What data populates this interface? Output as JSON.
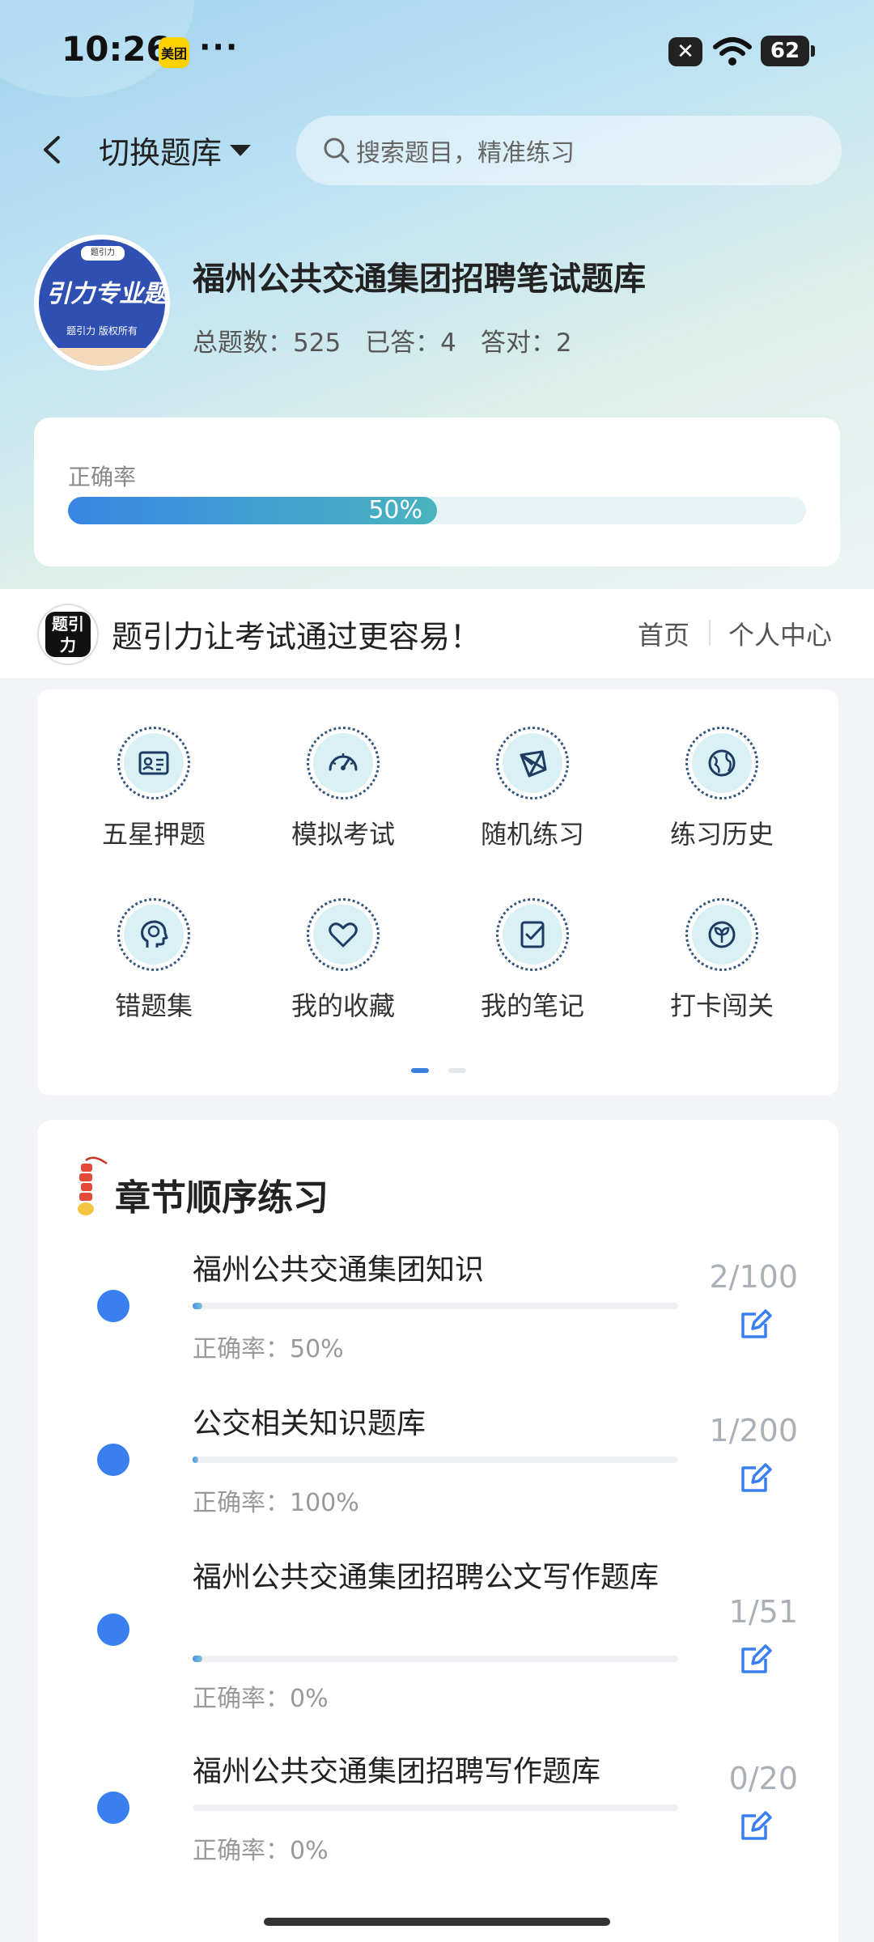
{
  "status_bar": {
    "time": "10:26",
    "meituan_badge": "美团",
    "more": "···",
    "battery": "62"
  },
  "header": {
    "switch_label": "切换题库",
    "search_placeholder": "搜索题目，精准练习"
  },
  "bank": {
    "logo_tab": "题引力",
    "logo_main": "引力专业题",
    "logo_sub": "题引力 版权所有",
    "title": "福州公共交通集团招聘笔试题库",
    "stats": {
      "total": "总题数：525",
      "answered": "已答：4",
      "correct": "答对：2"
    }
  },
  "accuracy": {
    "label": "正确率",
    "value_text": "50%",
    "fraction": 0.5
  },
  "brand_bar": {
    "logo_text": "题引力",
    "slogan": "题引力让考试通过更容易！",
    "home": "首页",
    "profile": "个人中心"
  },
  "features": [
    {
      "label": "五星押题",
      "icon": "id-card-icon"
    },
    {
      "label": "模拟考试",
      "icon": "speedometer-icon"
    },
    {
      "label": "随机练习",
      "icon": "network-icon"
    },
    {
      "label": "练习历史",
      "icon": "globe-icon"
    },
    {
      "label": "错题集",
      "icon": "brain-head-icon"
    },
    {
      "label": "我的收藏",
      "icon": "heart-icon"
    },
    {
      "label": "我的笔记",
      "icon": "note-check-icon"
    },
    {
      "label": "打卡闯关",
      "icon": "leaf-icon"
    }
  ],
  "chapters": {
    "title": "章节顺序练习",
    "items": [
      {
        "name": "福州公共交通集团知识",
        "accuracy": "正确率：50%",
        "count": "2/100",
        "progress": 0.02
      },
      {
        "name": "公交相关知识题库",
        "accuracy": "正确率：100%",
        "count": "1/200",
        "progress": 0.005
      },
      {
        "name": "福州公共交通集团招聘公文写作题库",
        "accuracy": "正确率：0%",
        "count": "1/51",
        "progress": 0.02
      },
      {
        "name": "福州公共交通集团招聘写作题库",
        "accuracy": "正确率：0%",
        "count": "0/20",
        "progress": 0
      }
    ]
  },
  "colors": {
    "accent": "#3a7ff0",
    "progress_start": "#3a86e4",
    "progress_end": "#49b4bf"
  }
}
